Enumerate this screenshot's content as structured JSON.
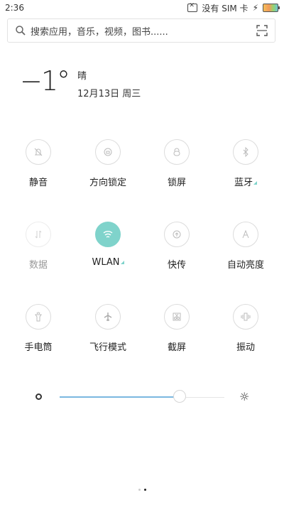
{
  "status_bar": {
    "time": "2:36",
    "sim_status": "没有 SIM 卡",
    "charging_icon": "bolt-icon"
  },
  "search": {
    "placeholder": "搜索应用，音乐，视频，图书......",
    "icon": "search-icon",
    "scan_icon": "scan-icon"
  },
  "weather": {
    "temperature": "−1°",
    "condition": "晴",
    "date": "12月13日 周三"
  },
  "toggles": [
    {
      "label": "静音",
      "icon": "bell-muted-icon",
      "state": "off",
      "more": false
    },
    {
      "label": "方向锁定",
      "icon": "rotation-lock-icon",
      "state": "off",
      "more": false
    },
    {
      "label": "锁屏",
      "icon": "lock-icon",
      "state": "off",
      "more": false
    },
    {
      "label": "蓝牙",
      "icon": "bluetooth-icon",
      "state": "off",
      "more": true
    },
    {
      "label": "数据",
      "icon": "data-icon",
      "state": "disabled",
      "more": false
    },
    {
      "label": "WLAN",
      "icon": "wifi-icon",
      "state": "on",
      "more": true
    },
    {
      "label": "快传",
      "icon": "transfer-icon",
      "state": "off",
      "more": false
    },
    {
      "label": "自动亮度",
      "icon": "auto-brightness-icon",
      "state": "off",
      "more": false
    },
    {
      "label": "手电筒",
      "icon": "flashlight-icon",
      "state": "off",
      "more": false
    },
    {
      "label": "飞行模式",
      "icon": "airplane-icon",
      "state": "off",
      "more": false
    },
    {
      "label": "截屏",
      "icon": "screenshot-icon",
      "state": "off",
      "more": false
    },
    {
      "label": "振动",
      "icon": "vibrate-icon",
      "state": "off",
      "more": false
    }
  ],
  "brightness": {
    "level": 0.73
  },
  "pager": {
    "pages": 2,
    "current": 2
  },
  "colors": {
    "accent": "#7fd3cb",
    "slider": "#7ab7e0"
  }
}
